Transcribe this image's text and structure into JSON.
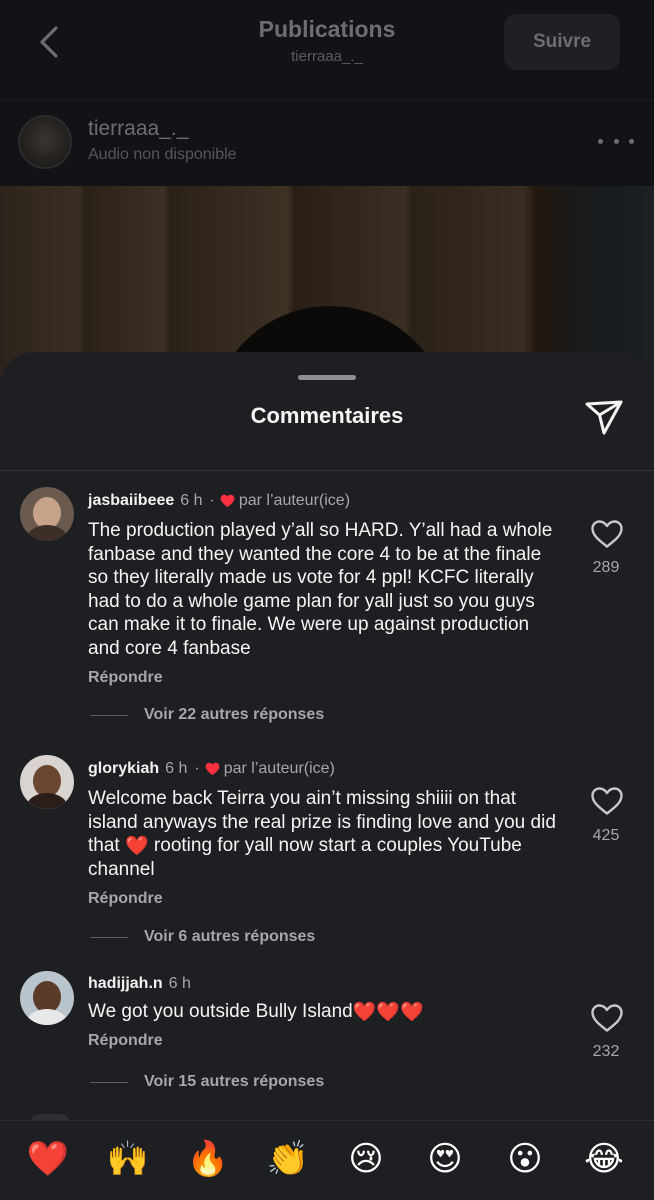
{
  "header": {
    "title": "Publications",
    "subtitle": "tierraaa_._",
    "follow_label": "Suivre"
  },
  "post": {
    "username": "tierraaa_._",
    "audio_status": "Audio non disponible"
  },
  "sheet": {
    "title": "Commentaires"
  },
  "comments": [
    {
      "username": "jasbaiibeee",
      "time": "6 h",
      "dot": "·",
      "liked_by_author": "par l’auteur(ice)",
      "text": "The production played y’all so HARD. Y’all had a whole fanbase and they wanted the core 4 to be at the finale so they literally made us vote for 4 ppl! KCFC literally had to do a whole game plan for yall just so you guys can make it to finale. We were up against production and core 4 fanbase",
      "reply_label": "Répondre",
      "likes": "289",
      "thread_label": "Voir 22 autres réponses"
    },
    {
      "username": "glorykiah",
      "time": "6 h",
      "dot": "·",
      "liked_by_author": "par l’auteur(ice)",
      "text_before": "Welcome back Teirra you ain’t missing shiiii on that island anyways the real prize is finding love and you did that ",
      "text_emoji": "❤️",
      "text_after": " rooting for yall now start a couples YouTube channel",
      "reply_label": "Répondre",
      "likes": "425",
      "thread_label": "Voir 6 autres réponses"
    },
    {
      "username": "hadijjah.n",
      "time": "6 h",
      "text": "We got you outside Bully Island",
      "text_emoji": "❤️❤️❤️",
      "reply_label": "Répondre",
      "likes": "232",
      "thread_label": "Voir 15 autres réponses"
    }
  ],
  "reactions": [
    "❤️",
    "🙌",
    "🔥",
    "👏",
    "😢",
    "😍",
    "😮",
    "😂"
  ],
  "colors": {
    "sheet_bg": "#1e1f22",
    "like_red": "#ff3040",
    "secondary_text": "#a5a7ab"
  }
}
